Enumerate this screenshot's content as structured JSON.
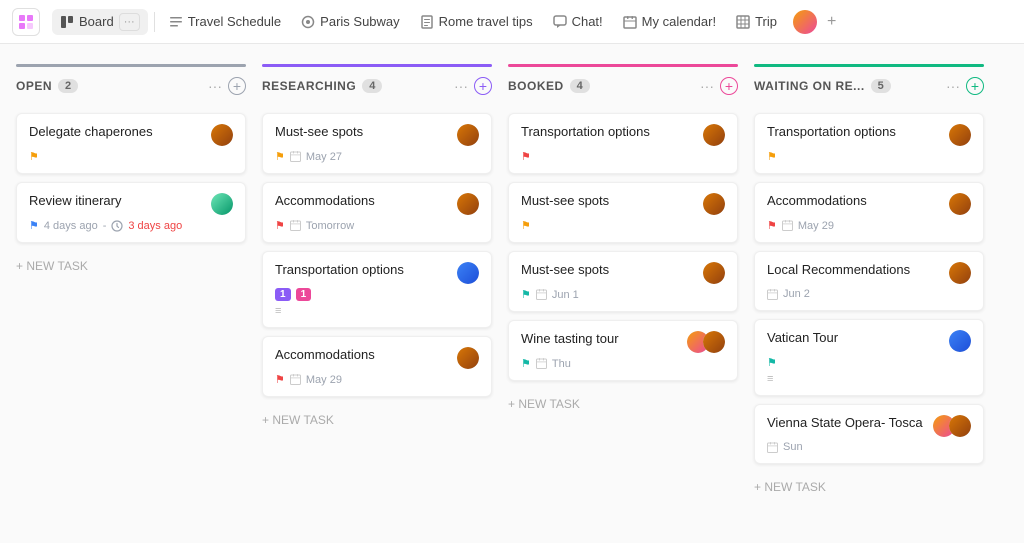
{
  "nav": {
    "app_icon": "grid",
    "items": [
      {
        "id": "board",
        "label": "Board",
        "icon": "board",
        "active": true,
        "has_dots": true
      },
      {
        "id": "travel-schedule",
        "label": "Travel Schedule",
        "icon": "list"
      },
      {
        "id": "paris-subway",
        "label": "Paris Subway",
        "icon": "circle"
      },
      {
        "id": "rome-travel-tips",
        "label": "Rome travel tips",
        "icon": "doc"
      },
      {
        "id": "chat",
        "label": "Chat!",
        "icon": "chat"
      },
      {
        "id": "my-calendar",
        "label": "My calendar!",
        "icon": "calendar"
      },
      {
        "id": "trip",
        "label": "Trip",
        "icon": "table"
      }
    ],
    "plus_label": "+"
  },
  "columns": [
    {
      "id": "open",
      "title": "OPEN",
      "count": "2",
      "bar_class": "bar-gray",
      "plus_class": "",
      "cards": [
        {
          "id": "delegate-chaperones",
          "title": "Delegate chaperones",
          "avatar_class": "brown",
          "flag": "yellow",
          "meta": ""
        },
        {
          "id": "review-itinerary",
          "title": "Review itinerary",
          "avatar_class": "",
          "flag": "blue",
          "meta_left": "4 days ago",
          "meta_sep": "-",
          "meta_right": "3 days ago",
          "meta_right_class": "overdue",
          "has_clock": true
        }
      ],
      "new_task_label": "+ NEW TASK"
    },
    {
      "id": "researching",
      "title": "RESEARCHING",
      "count": "4",
      "bar_class": "bar-purple",
      "plus_class": "purple",
      "cards": [
        {
          "id": "must-see-spots-r",
          "title": "Must-see spots",
          "avatar_class": "brown",
          "flag": "yellow",
          "meta": "May 27",
          "has_cal": true
        },
        {
          "id": "accommodations-r",
          "title": "Accommodations",
          "avatar_class": "brown",
          "flag": "red",
          "meta": "Tomorrow",
          "has_cal": true
        },
        {
          "id": "transportation-options-r",
          "title": "Transportation options",
          "avatar_class": "blue",
          "flag": "",
          "meta": "",
          "tag1": "1",
          "tag1_class": "tag-purple",
          "tag2": "1",
          "tag2_class": "tag-pink",
          "has_icons": true
        },
        {
          "id": "accommodations-r2",
          "title": "Accommodations",
          "avatar_class": "brown",
          "flag": "red",
          "meta": "May 29",
          "has_cal": true
        }
      ],
      "new_task_label": "+ NEW TASK"
    },
    {
      "id": "booked",
      "title": "BOOKED",
      "count": "4",
      "bar_class": "bar-pink",
      "plus_class": "pink",
      "cards": [
        {
          "id": "transportation-options-b",
          "title": "Transportation options",
          "avatar_class": "brown",
          "flag": "red",
          "meta": ""
        },
        {
          "id": "must-see-spots-b",
          "title": "Must-see spots",
          "avatar_class": "brown",
          "flag": "yellow",
          "meta": ""
        },
        {
          "id": "must-see-spots-b2",
          "title": "Must-see spots",
          "avatar_class": "brown",
          "flag": "teal",
          "meta": "Jun 1",
          "has_cal": true
        },
        {
          "id": "wine-tasting-tour",
          "title": "Wine tasting tour",
          "avatar_class": "multi",
          "avatar_class2": "brown",
          "flag": "teal",
          "meta": "Thu",
          "has_cal": true,
          "double_avatar": true
        }
      ],
      "new_task_label": "+ NEW TASK"
    },
    {
      "id": "waiting-on-re",
      "title": "WAITING ON RE...",
      "count": "5",
      "bar_class": "bar-green",
      "plus_class": "green",
      "cards": [
        {
          "id": "transportation-options-w",
          "title": "Transportation options",
          "avatar_class": "brown",
          "flag": "yellow",
          "meta": ""
        },
        {
          "id": "accommodations-w",
          "title": "Accommodations",
          "avatar_class": "brown",
          "flag": "red",
          "meta": "May 29",
          "has_cal": true
        },
        {
          "id": "local-recommendations",
          "title": "Local Recommendations",
          "avatar_class": "brown",
          "flag": "",
          "meta": "Jun 2",
          "has_cal": true
        },
        {
          "id": "vatican-tour",
          "title": "Vatican Tour",
          "avatar_class": "blue",
          "flag": "teal",
          "meta": "",
          "has_icons": true
        },
        {
          "id": "vienna-state-opera",
          "title": "Vienna State Opera- Tosca",
          "avatar_class": "multi",
          "avatar_class2": "brown",
          "flag": "",
          "meta": "Sun",
          "has_cal": true,
          "double_avatar": true
        }
      ],
      "new_task_label": "+ NEW TASK"
    }
  ]
}
